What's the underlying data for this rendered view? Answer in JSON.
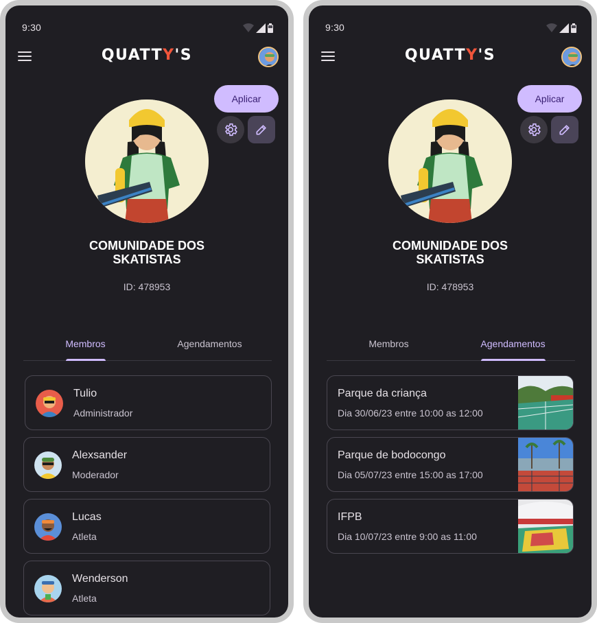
{
  "status": {
    "time": "9:30"
  },
  "app": {
    "logo_prefix": "QUATT",
    "logo_accent": "Y",
    "logo_suffix": "'S",
    "accent_color": "#f0553b"
  },
  "actions": {
    "apply_label": "Aplicar",
    "settings_icon": "gear-icon",
    "edit_icon": "pencil-icon"
  },
  "community": {
    "name": "COMUNIDADE DOS SKATISTAS",
    "id_label": "ID: 478953"
  },
  "tabs": [
    {
      "label": "Membros"
    },
    {
      "label": "Agendamentos"
    }
  ],
  "left_screen": {
    "active_tab": "Membros"
  },
  "right_screen": {
    "active_tab": "Agendamentos"
  },
  "members": [
    {
      "name": "Tulio",
      "role": "Administrador"
    },
    {
      "name": "Alexsander",
      "role": "Moderador"
    },
    {
      "name": "Lucas",
      "role": "Atleta"
    },
    {
      "name": "Wenderson",
      "role": "Atleta"
    }
  ],
  "schedules": [
    {
      "place": "Parque da criança",
      "when": "Dia 30/06/23 entre 10:00 as 12:00"
    },
    {
      "place": "Parque de bodocongo",
      "when": "Dia 05/07/23 entre 15:00 as 17:00"
    },
    {
      "place": "IFPB",
      "when": "Dia 10/07/23 entre 9:00 as 11:00"
    }
  ],
  "colors": {
    "background": "#1f1e23",
    "primary": "#d0bcff",
    "on_primary": "#381e72",
    "text": "#e6e1e6",
    "text_secondary": "#cac4d0"
  }
}
